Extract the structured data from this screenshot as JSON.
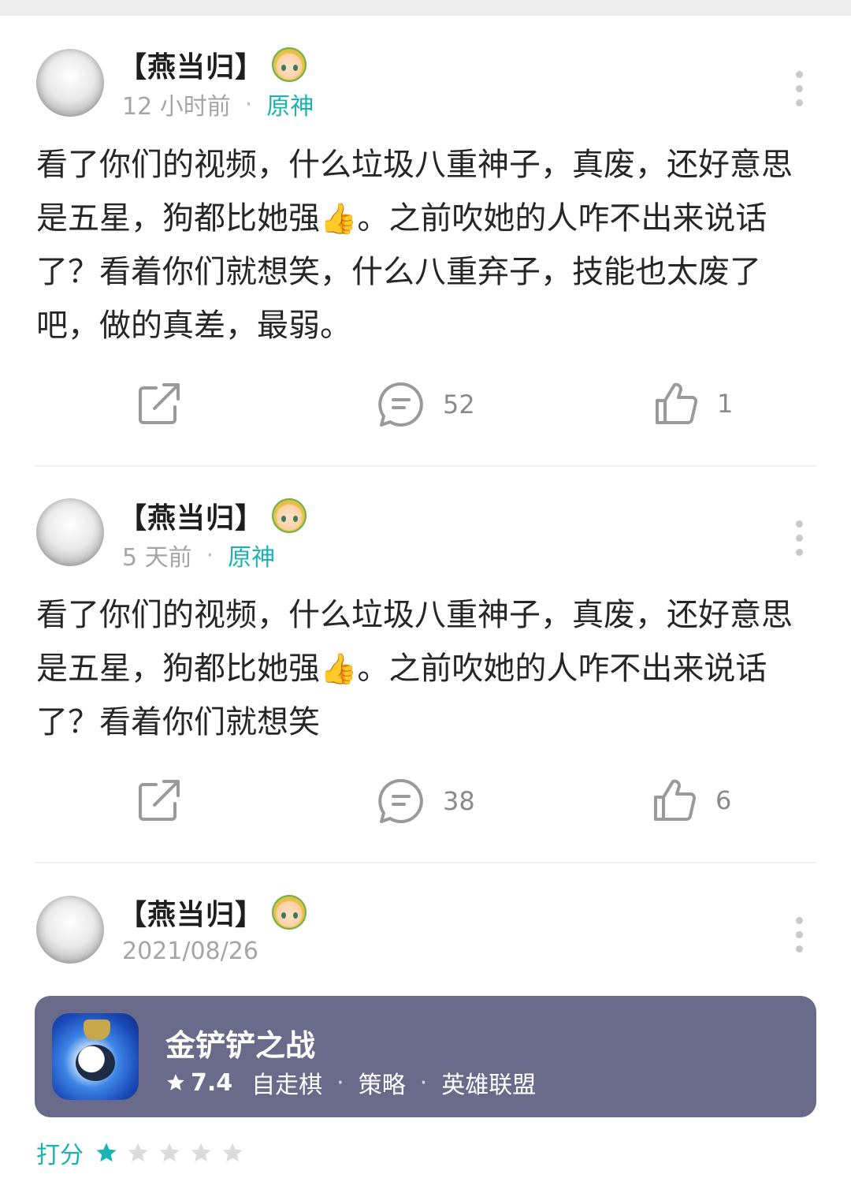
{
  "posts": [
    {
      "username": "【燕当归】",
      "time": "12 小时前",
      "game": "原神",
      "text_before": "看了你们的视频，什么垃圾八重神子，真废，还好意思是五星，狗都比她强",
      "emoji": "👍",
      "text_after": "。之前吹她的人咋不出来说话了？看着你们就想笑，什么八重弃子，技能也太废了吧，做的真差，最弱。",
      "comments": "52",
      "likes": "1"
    },
    {
      "username": "【燕当归】",
      "time": "5 天前",
      "game": "原神",
      "text_before": "看了你们的视频，什么垃圾八重神子，真废，还好意思是五星，狗都比她强",
      "emoji": "👍",
      "text_after": "。之前吹她的人咋不出来说话了？看着你们就想笑",
      "comments": "38",
      "likes": "6"
    },
    {
      "username": "【燕当归】",
      "time": "2021/08/26"
    }
  ],
  "game_card": {
    "title": "金铲铲之战",
    "rating": "7.4",
    "tags": [
      "自走棋",
      "策略",
      "英雄联盟"
    ]
  },
  "review": {
    "label": "打分",
    "stars_filled": 1,
    "stars_total": 5
  },
  "colors": {
    "accent": "#19b3b3",
    "card_bg": "#6a6a8b",
    "icon_gray": "#9a9a9a"
  }
}
